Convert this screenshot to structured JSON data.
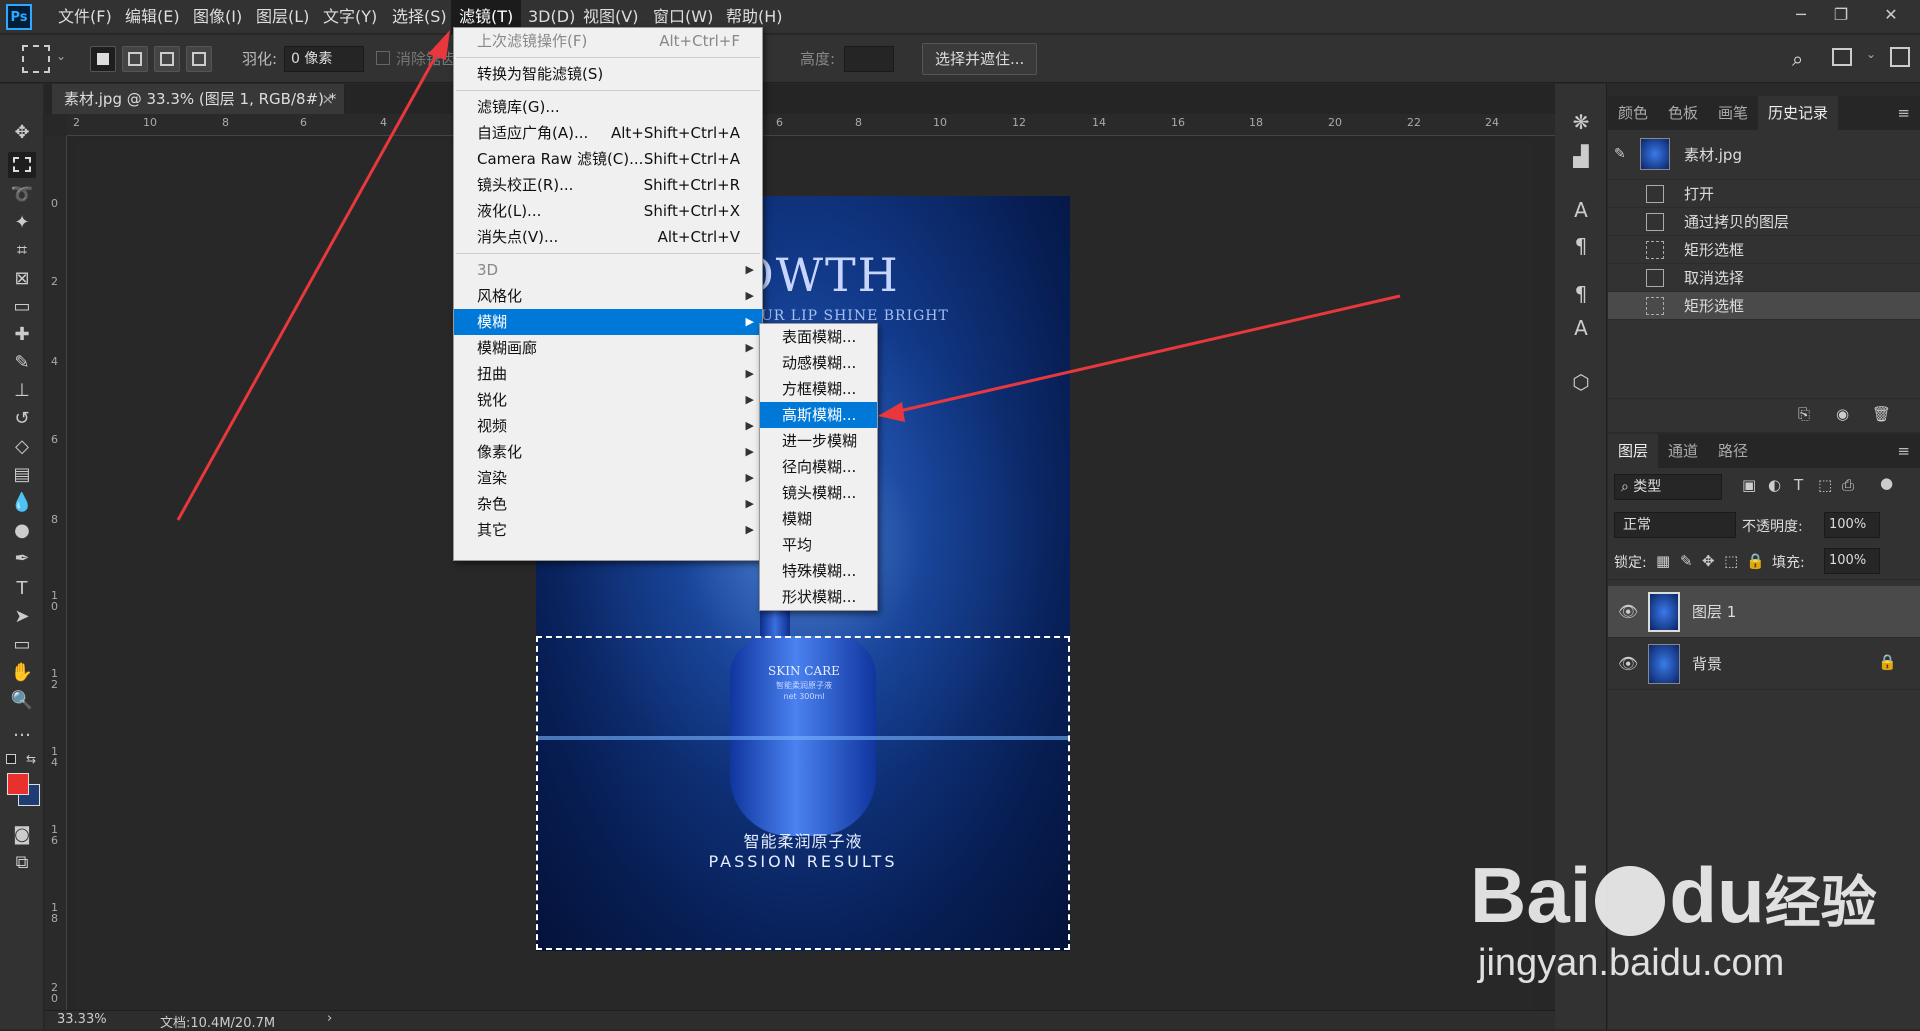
{
  "menubar": {
    "logo": "Ps",
    "items": [
      "文件(F)",
      "编辑(E)",
      "图像(I)",
      "图层(L)",
      "文字(Y)",
      "选择(S)",
      "滤镜(T)",
      "3D(D)",
      "视图(V)",
      "窗口(W)",
      "帮助(H)"
    ],
    "active": "滤镜(T)"
  },
  "options": {
    "feather_label": "羽化:",
    "feather_value": "0 像素",
    "antialias_label": "消除锯齿",
    "height_label": "高度:",
    "select_mask_button": "选择并遮住..."
  },
  "document": {
    "tab_title": "素材.jpg @ 33.3% (图层 1, RGB/8#) *",
    "tab_close": "×",
    "ruler_top": [
      "2",
      "10",
      "8",
      "6",
      "4",
      "2",
      "0",
      "2",
      "4",
      "6",
      "8",
      "10",
      "12",
      "14",
      "16",
      "18",
      "20",
      "22",
      "24"
    ],
    "ruler_left": [
      "0",
      "2",
      "4",
      "6",
      "8",
      "10",
      "12",
      "14",
      "16",
      "18",
      "20"
    ],
    "image_text": {
      "headline": "OWTH",
      "subline": "UR LIP SHINE BRIGHT",
      "bottle_label": "SKIN CARE",
      "bottle_sub1": "智能柔润原子液",
      "bottle_sub2": "net 300ml",
      "cn_caption": "智能柔润原子液",
      "en_caption": "PASSION RESULTS"
    }
  },
  "filter_menu": {
    "last_filter": {
      "label": "上次滤镜操作(F)",
      "shortcut": "Alt+Ctrl+F"
    },
    "smart": "转换为智能滤镜(S)",
    "group1": [
      {
        "label": "滤镜库(G)...",
        "shortcut": ""
      },
      {
        "label": "自适应广角(A)...",
        "shortcut": "Alt+Shift+Ctrl+A"
      },
      {
        "label": "Camera Raw 滤镜(C)...",
        "shortcut": "Shift+Ctrl+A"
      },
      {
        "label": "镜头校正(R)...",
        "shortcut": "Shift+Ctrl+R"
      },
      {
        "label": "液化(L)...",
        "shortcut": "Shift+Ctrl+X"
      },
      {
        "label": "消失点(V)...",
        "shortcut": "Alt+Ctrl+V"
      }
    ],
    "group2": [
      "3D",
      "风格化",
      "模糊",
      "模糊画廊",
      "扭曲",
      "锐化",
      "视频",
      "像素化",
      "渲染",
      "杂色",
      "其它"
    ],
    "highlighted": "模糊"
  },
  "blur_submenu": {
    "items": [
      "表面模糊...",
      "动感模糊...",
      "方框模糊...",
      "高斯模糊...",
      "进一步模糊",
      "径向模糊...",
      "镜头模糊...",
      "模糊",
      "平均",
      "特殊模糊...",
      "形状模糊..."
    ],
    "highlighted": "高斯模糊..."
  },
  "status": {
    "zoom": "33.33%",
    "doc": "文档:10.4M/20.7M",
    "arrow": "›"
  },
  "history_panel": {
    "tabs": [
      "颜色",
      "色板",
      "画笔",
      "历史记录"
    ],
    "active_tab": "历史记录",
    "snapshot": "素材.jpg",
    "items": [
      "打开",
      "通过拷贝的图层",
      "矩形选框",
      "取消选择",
      "矩形选框"
    ]
  },
  "layers_panel": {
    "tabs": [
      "图层",
      "通道",
      "路径"
    ],
    "filter_label": "类型",
    "blend_mode": "正常",
    "opacity_label": "不透明度:",
    "opacity_value": "100%",
    "lock_label": "锁定:",
    "fill_label": "填充:",
    "fill_value": "100%",
    "layers": [
      {
        "name": "图层 1",
        "selected": true
      },
      {
        "name": "背景",
        "selected": false
      }
    ]
  },
  "watermark": {
    "brand": "Bai",
    "brand2": "du",
    "cn": "经验",
    "url": "jingyan.baidu.com"
  },
  "colors": {
    "accent": "#0078d7",
    "arrow": "#e8383d",
    "foreground": "#e8302c",
    "background": "#1e3d73"
  }
}
